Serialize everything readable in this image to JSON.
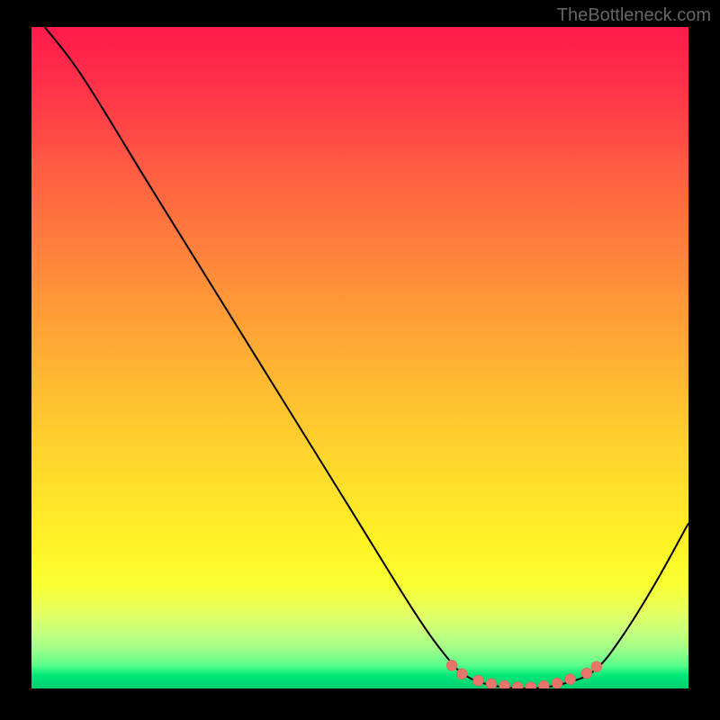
{
  "watermark": "TheBottleneck.com",
  "chart_data": {
    "type": "line",
    "title": "",
    "xlabel": "",
    "ylabel": "",
    "xlim": [
      0,
      100
    ],
    "ylim": [
      0,
      100
    ],
    "series": [
      {
        "name": "curve",
        "points": [
          {
            "x": 2,
            "y": 100
          },
          {
            "x": 6,
            "y": 95
          },
          {
            "x": 10,
            "y": 89
          },
          {
            "x": 18,
            "y": 76
          },
          {
            "x": 28,
            "y": 60
          },
          {
            "x": 38,
            "y": 44
          },
          {
            "x": 48,
            "y": 28
          },
          {
            "x": 58,
            "y": 12
          },
          {
            "x": 63,
            "y": 5
          },
          {
            "x": 66,
            "y": 2
          },
          {
            "x": 70,
            "y": 0.5
          },
          {
            "x": 76,
            "y": 0
          },
          {
            "x": 82,
            "y": 1
          },
          {
            "x": 86,
            "y": 3
          },
          {
            "x": 90,
            "y": 8
          },
          {
            "x": 95,
            "y": 16
          },
          {
            "x": 100,
            "y": 25
          }
        ]
      }
    ],
    "markers": [
      {
        "x": 64,
        "y": 3.5
      },
      {
        "x": 65.5,
        "y": 2.2
      },
      {
        "x": 68,
        "y": 1.2
      },
      {
        "x": 70,
        "y": 0.7
      },
      {
        "x": 72,
        "y": 0.4
      },
      {
        "x": 74,
        "y": 0.2
      },
      {
        "x": 76,
        "y": 0.2
      },
      {
        "x": 78,
        "y": 0.4
      },
      {
        "x": 80,
        "y": 0.8
      },
      {
        "x": 82,
        "y": 1.4
      },
      {
        "x": 84.5,
        "y": 2.3
      },
      {
        "x": 86,
        "y": 3.3
      }
    ],
    "gradient": {
      "top_color": "#ff1a4a",
      "bottom_color": "#00d070",
      "description": "red-yellow-green vertical gradient"
    }
  }
}
